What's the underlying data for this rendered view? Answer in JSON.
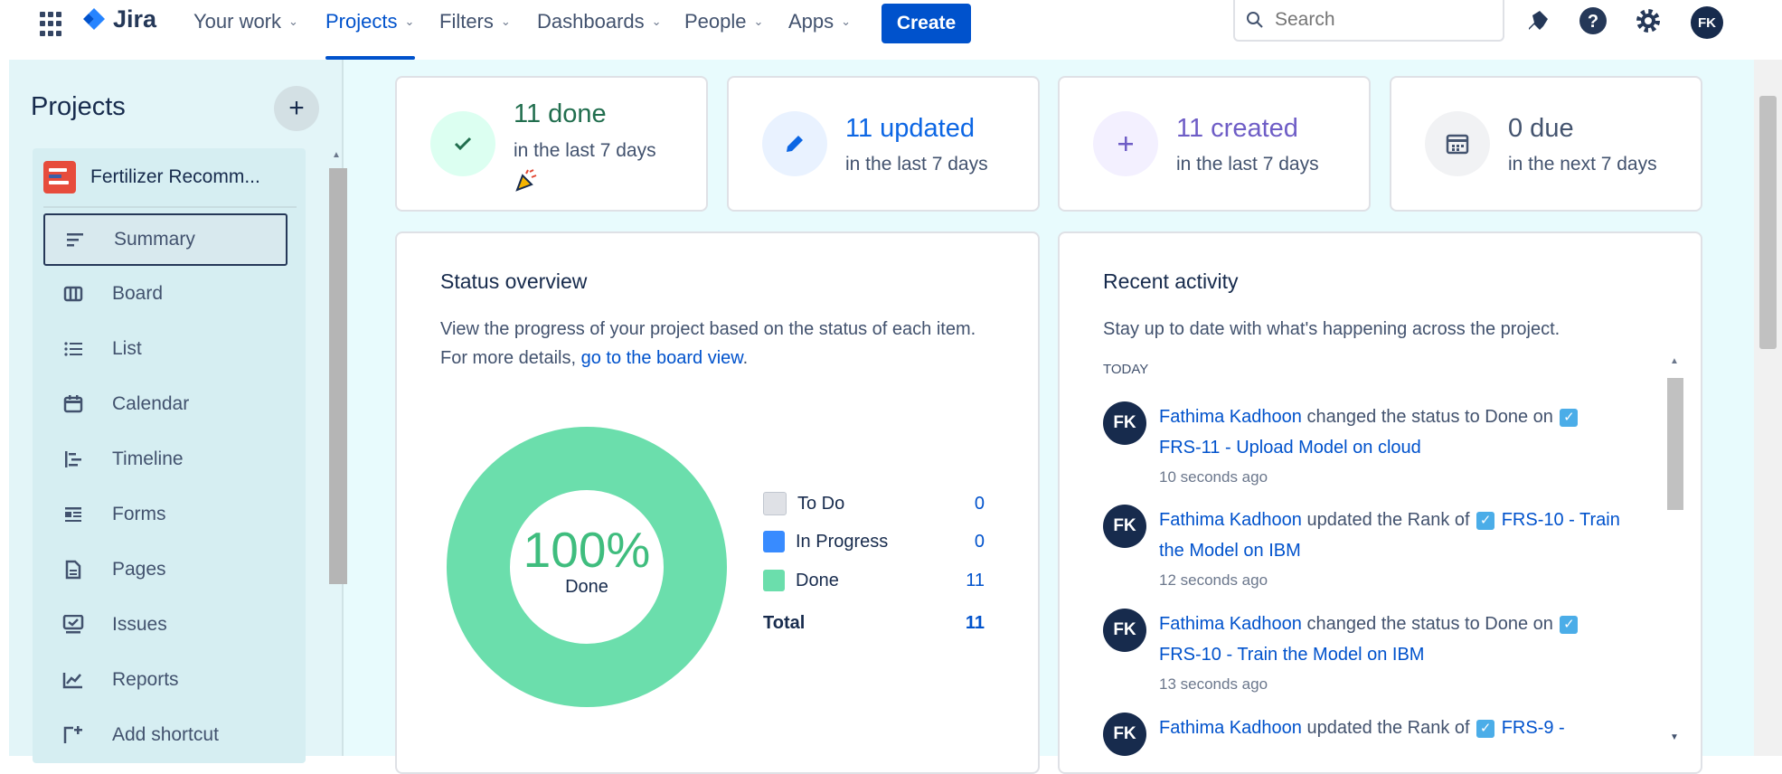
{
  "nav": {
    "logo": "Jira",
    "items": [
      {
        "label": "Your work"
      },
      {
        "label": "Projects"
      },
      {
        "label": "Filters"
      },
      {
        "label": "Dashboards"
      },
      {
        "label": "People"
      },
      {
        "label": "Apps"
      }
    ],
    "create": "Create",
    "search_placeholder": "Search",
    "avatar": "FK"
  },
  "sidebar": {
    "title": "Projects",
    "project_name": "Fertilizer Recomm...",
    "items": [
      {
        "label": "Summary",
        "icon": "summary-icon"
      },
      {
        "label": "Board",
        "icon": "board-icon"
      },
      {
        "label": "List",
        "icon": "list-icon"
      },
      {
        "label": "Calendar",
        "icon": "calendar-icon"
      },
      {
        "label": "Timeline",
        "icon": "timeline-icon"
      },
      {
        "label": "Forms",
        "icon": "forms-icon"
      },
      {
        "label": "Pages",
        "icon": "pages-icon"
      },
      {
        "label": "Issues",
        "icon": "issues-icon"
      },
      {
        "label": "Reports",
        "icon": "reports-icon"
      },
      {
        "label": "Add shortcut",
        "icon": "add-shortcut-icon"
      }
    ]
  },
  "stats": [
    {
      "main": "11 done",
      "sub": "in the last 7 days",
      "color": "#216e4e",
      "bg": "#dcfff1"
    },
    {
      "main": "11 updated",
      "sub": "in the last 7 days",
      "color": "#0c66e4",
      "bg": "#e9f2ff"
    },
    {
      "main": "11 created",
      "sub": "in the last 7 days",
      "color": "#6e5dc6",
      "bg": "#f3f0ff"
    },
    {
      "main": "0 due",
      "sub": "in the next 7 days",
      "color": "#44546f",
      "bg": "#f1f2f4"
    }
  ],
  "status": {
    "title": "Status overview",
    "desc": "View the progress of your project based on the status of each item. For more details,",
    "link": "go to the board view",
    "link_suffix": ".",
    "center_pct": "100%",
    "center_label": "Done",
    "total_label": "Total",
    "total_value": "11"
  },
  "chart_data": {
    "type": "pie",
    "categories": [
      "To Do",
      "In Progress",
      "Done"
    ],
    "values": [
      0,
      0,
      11
    ],
    "colors": [
      "#dfe1e6",
      "#388bff",
      "#6bdeac"
    ]
  },
  "activity": {
    "title": "Recent activity",
    "desc": "Stay up to date with what's happening across the project.",
    "section": "TODAY",
    "items": [
      {
        "avatar": "FK",
        "user": "Fathima Kadhoon",
        "action": "changed the status to Done on",
        "issue": "FRS-11 - Upload Model on cloud",
        "time": "10 seconds ago"
      },
      {
        "avatar": "FK",
        "user": "Fathima Kadhoon",
        "action": "updated the Rank of",
        "issue": "FRS-10 - Train the Model on IBM",
        "time": "12 seconds ago"
      },
      {
        "avatar": "FK",
        "user": "Fathima Kadhoon",
        "action": "changed the status to Done on",
        "issue": "FRS-10 - Train the Model on IBM",
        "time": "13 seconds ago"
      },
      {
        "avatar": "FK",
        "user": "Fathima Kadhoon",
        "action": "updated the Rank of",
        "issue": "FRS-9 -",
        "time": ""
      }
    ]
  }
}
